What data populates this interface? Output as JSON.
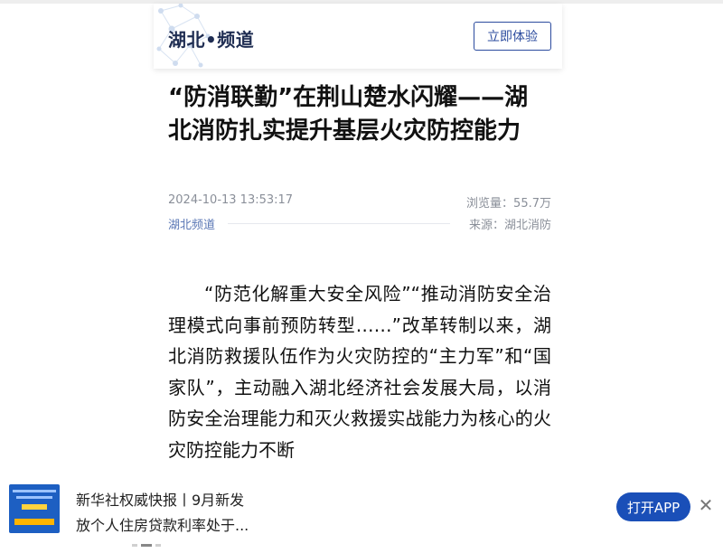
{
  "header": {
    "brand": "湖北•频道",
    "cta_label": "立即体验"
  },
  "article": {
    "title": "“防消联勤”在荆山楚水闪耀——湖北消防扎实提升基层火灾防控能力",
    "datetime": "2024-10-13 13:53:17",
    "views": "浏览量：55.7万",
    "channel": "湖北频道",
    "source": "来源：湖北消防",
    "body": "“防范化解重大安全风险”“推动消防安全治理模式向事前预防转型……”改革转制以来，湖北消防救援队伍作为火灾防控的“主力军”和“国家队”，主动融入湖北经济社会发展大局，以消防安全治理能力和灭火救援实战能力为核心的火灾防控能力不断"
  },
  "bottom_banner": {
    "headline": "新华社权威快报丨9月新发",
    "subline": "放个人住房贷款利率处于...",
    "open_app_label": "打开APP",
    "close_icon": "close-icon",
    "carousel_pages": 3,
    "carousel_active_index": 1
  }
}
